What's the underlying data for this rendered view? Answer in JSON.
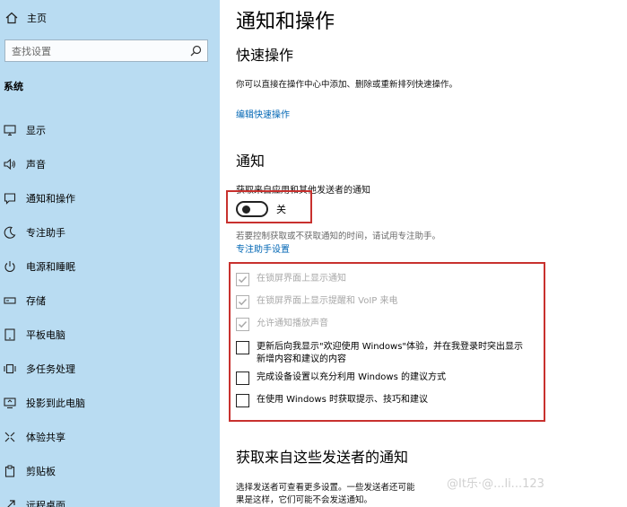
{
  "sidebar": {
    "home_label": "主页",
    "home_icon": "home-icon",
    "search_placeholder": "查找设置",
    "search_icon": "search-icon",
    "section_label": "系统",
    "items": [
      {
        "label": "显示",
        "icon": "monitor-icon"
      },
      {
        "label": "声音",
        "icon": "speaker-icon"
      },
      {
        "label": "通知和操作",
        "icon": "notification-icon"
      },
      {
        "label": "专注助手",
        "icon": "moon-icon"
      },
      {
        "label": "电源和睡眠",
        "icon": "power-icon"
      },
      {
        "label": "存储",
        "icon": "storage-icon"
      },
      {
        "label": "平板电脑",
        "icon": "tablet-icon"
      },
      {
        "label": "多任务处理",
        "icon": "multitask-icon"
      },
      {
        "label": "投影到此电脑",
        "icon": "projection-icon"
      },
      {
        "label": "体验共享",
        "icon": "share-icon"
      },
      {
        "label": "剪贴板",
        "icon": "clipboard-icon"
      },
      {
        "label": "远程桌面",
        "icon": "remote-desktop-icon"
      }
    ],
    "background_color": "#b9dcf2"
  },
  "main": {
    "title": "通知和操作",
    "quick_actions": {
      "heading": "快速操作",
      "description": "你可以直接在操作中心中添加、删除或重新排列快速操作。",
      "link": "编辑快速操作"
    },
    "notifications": {
      "heading": "通知",
      "toggle_label": "获取来自应用和其他发送者的通知",
      "toggle_state_text": "关",
      "toggle_on": false,
      "hint": "若要控制获取或不获取通知的时间，请试用专注助手。",
      "focus_link": "专注助手设置",
      "checkboxes": [
        {
          "label": "在锁屏界面上显示通知",
          "checked": true,
          "disabled": true
        },
        {
          "label": "在锁屏界面上显示提醒和 VoIP 来电",
          "checked": true,
          "disabled": true
        },
        {
          "label": "允许通知播放声音",
          "checked": true,
          "disabled": true
        },
        {
          "label": "更新后向我显示\"欢迎使用 Windows\"体验，并在我登录时突出显示",
          "label_line2": "新增内容和建议的内容",
          "checked": false,
          "disabled": false
        },
        {
          "label": "完成设备设置以充分利用 Windows 的建议方式",
          "checked": false,
          "disabled": false
        },
        {
          "label": "在使用 Windows 时获取提示、技巧和建议",
          "checked": false,
          "disabled": false
        }
      ]
    },
    "senders": {
      "heading": "获取来自这些发送者的通知",
      "description_line1": "选择发送者可查看更多设置。一些发送者还可能",
      "description_line2": "果是这样，它们可能不会发送通知。"
    },
    "watermark": "@It乐·@...li...123"
  },
  "colors": {
    "link": "#0066b4",
    "highlight_border": "#c8312e"
  }
}
